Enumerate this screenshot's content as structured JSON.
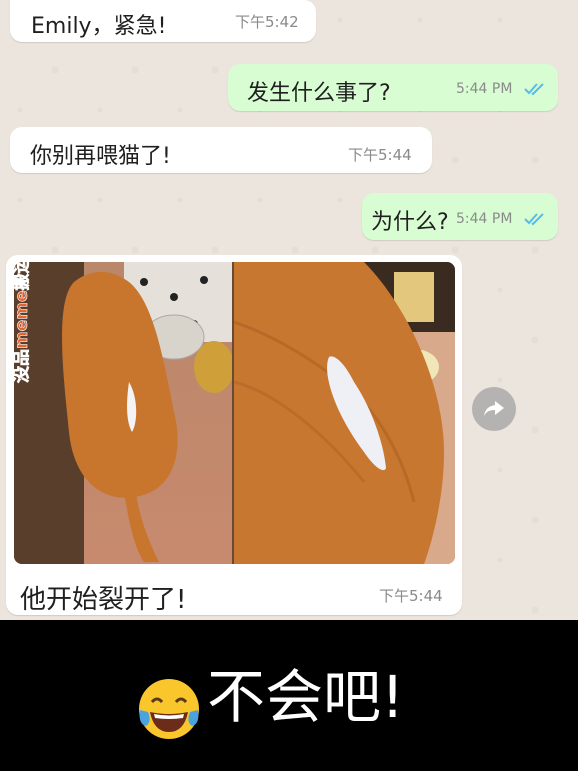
{
  "messages": [
    {
      "text": "Emily，紧急!",
      "time": "下午5:42"
    },
    {
      "text": "发生什么事了?",
      "time": "5:44 PM"
    },
    {
      "text": "你别再喂猫了!",
      "time": "下午5:44"
    },
    {
      "text": "为什么?",
      "time": "5:44 PM"
    },
    {
      "text": "他开始裂开了!",
      "time": "下午5:44"
    }
  ],
  "watermark": "没品meme搬运",
  "caption": "不会吧!",
  "icons": {
    "read_receipt": "double-check-icon",
    "forward": "forward-icon",
    "emoji": "tears-of-joy-emoji-icon"
  },
  "colors": {
    "incoming_bubble": "#ffffff",
    "outgoing_bubble": "#d9fdd3",
    "read_tick": "#53bdeb",
    "caption_bar": "#000000",
    "watermark": "#e8622a"
  }
}
